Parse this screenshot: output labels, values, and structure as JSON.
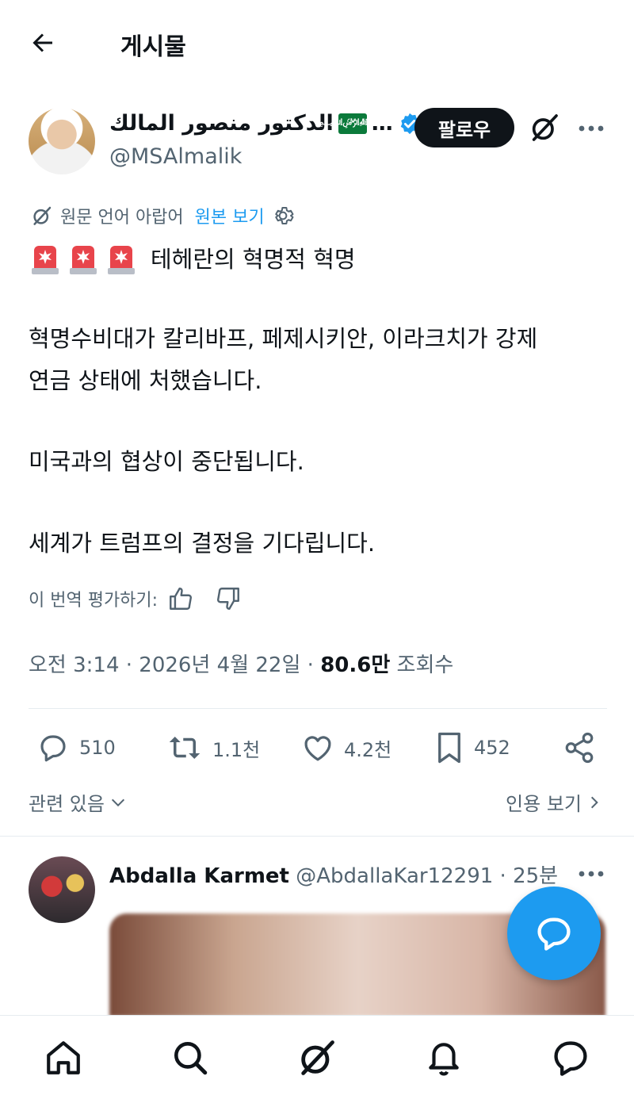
{
  "header": {
    "title": "게시물"
  },
  "author": {
    "name": "الدكتور منصور المالك",
    "flag_emoji_text": "🇸🇦",
    "ellipsis": "…",
    "handle": "@MSAlmalik",
    "follow_label": "팔로우"
  },
  "translation": {
    "source_label": "원문 언어 아랍어",
    "link_label": "원본 보기"
  },
  "post": {
    "line1": "테헤란의 혁명적 혁명",
    "line2": "혁명수비대가 칼리바프, 페제시키안, 이라크치가 강제",
    "line3": "연금 상태에 처했습니다.",
    "line4": "미국과의 협상이 중단됩니다.",
    "line5": "세계가 트럼프의 결정을 기다립니다."
  },
  "rating": {
    "label": "이 번역 평가하기:"
  },
  "meta": {
    "time": "오전 3:14",
    "date": "2026년 4월 22일",
    "views": "80.6만",
    "views_label": "조회수",
    "sep": "·"
  },
  "actions": {
    "replies": "510",
    "reposts": "1.1천",
    "likes": "4.2천",
    "bookmarks": "452"
  },
  "links": {
    "related": "관련 있음",
    "quotes": "인용 보기"
  },
  "reply": {
    "name": "Abdalla Karmet",
    "handle": "@AbdallaKar12291",
    "sep": "·",
    "time": "25분"
  },
  "colors": {
    "accent": "#1d9bf0",
    "text": "#0f1419",
    "muted": "#536471"
  }
}
